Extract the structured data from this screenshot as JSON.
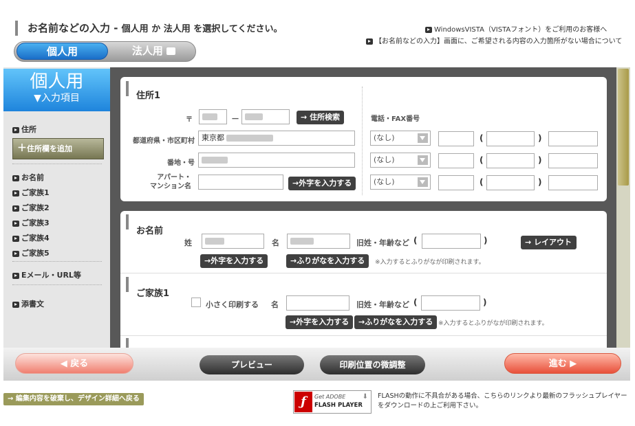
{
  "header": {
    "title_main": "お名前などの入力 - ",
    "title_sub": "個人用 か 法人用 を選択してください。",
    "link_vista": "WindowsVISTA（VISTAフォント）をご利用のお客様へ",
    "link_missing": "【お名前などの入力】画面に、ご希望される内容の入力箇所がない場合について"
  },
  "tabs": {
    "individual": "個人用",
    "corporate": "法人用"
  },
  "sidebar": {
    "head_big": "個人用",
    "head_small": "▼入力項目",
    "address": "住所",
    "add_address": "住所欄を追加",
    "items": [
      "お名前",
      "ご家族1",
      "ご家族2",
      "ご家族3",
      "ご家族4",
      "ご家族5"
    ],
    "email": "Eメール・URL等",
    "attachment": "添書文"
  },
  "address_section": {
    "title": "住所1",
    "postal_mark": "〒",
    "postal_dash": "－",
    "search_button": "住所検索",
    "pref_label": "都道府県・市区町村",
    "pref_value": "東京都",
    "banchi_label": "番地・号",
    "apart_label_1": "アパート・",
    "apart_label_2": "マンション名",
    "gaiji_button": "外字を入力する",
    "phone_title": "電話・FAX番号",
    "phone_select": "(なし)",
    "open_paren": "(",
    "close_paren": ")"
  },
  "name_section": {
    "title": "お名前",
    "sei_label": "姓",
    "mei_label": "名",
    "old_name_label": "旧姓・年齢など",
    "open_paren": "(",
    "close_paren": ")",
    "layout_button": "レイアウト",
    "gaiji_button": "外字を入力する",
    "furigana_button": "ふりがなを入力する",
    "note": "※入力するとふりがなが印刷されます。"
  },
  "family_section": {
    "title": "ご家族1",
    "small_print": "小さく印刷する",
    "mei_label": "名",
    "old_name_label": "旧姓・年齢など",
    "open_paren": "(",
    "close_paren": ")",
    "gaiji_button": "外字を入力する",
    "furigana_button": "ふりがなを入力する",
    "note": "※入力するとふりがなが印刷されます。"
  },
  "bottom": {
    "back": "戻る",
    "preview": "プレビュー",
    "adjust": "印刷位置の微調整",
    "next": "進む"
  },
  "footer": {
    "discard_link": "編集内容を破棄し、デザイン詳細へ戻る",
    "flash_get": "Get ADOBE",
    "flash_player": "FLASH PLAYER",
    "flash_note": "FLASHの動作に不具合がある場合、こちらのリンクより最新のフラッシュプレイヤーをダウンロードの上ご利用下さい。"
  },
  "colors": {
    "accent_blue": "#1e84dc",
    "next_red": "#e8503a",
    "back_red": "#f07f70",
    "dark_button": "#404040"
  }
}
